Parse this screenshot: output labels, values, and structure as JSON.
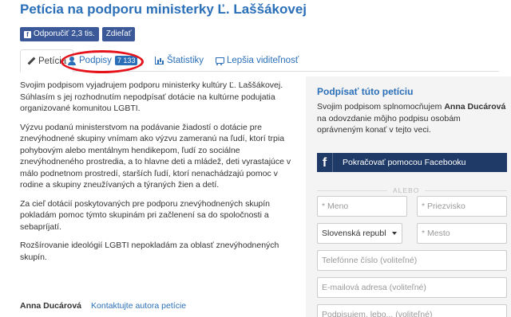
{
  "page": {
    "title": "Petícia na podporu ministerky Ľ. Laššákovej"
  },
  "share": {
    "recommend_label": "Odporučiť",
    "recommend_count": "2,3 tis.",
    "share_label": "Zdieľať"
  },
  "tabs": [
    {
      "label": "Petícia",
      "icon": "pencil-icon",
      "active": true
    },
    {
      "label": "Podpisy",
      "icon": "user-icon",
      "badge": "7 133",
      "active": false
    },
    {
      "label": "Štatistiky",
      "icon": "chart-icon",
      "active": false
    },
    {
      "label": "Lepšia viditeľnosť",
      "icon": "cart-icon",
      "active": false
    }
  ],
  "annotation": {
    "color": "#e5141c"
  },
  "body": {
    "paragraphs": [
      "Svojim podpisom vyjadrujem podporu ministerky kultúry Ľ. Laššákovej. Súhlasím s jej rozhodnutím nepodpísať dotácie na kultúrne podujatia organizované komunitou LGBTI.",
      "Výzvu podanú ministerstvom na podávanie žiadostí o dotácie pre znevýhodnené skupiny vnímam ako výzvu zameranú na ľudí, ktorí trpia pohybovým alebo mentálnym hendikepom, ľudí zo sociálne znevýhodneného prostredia, a to hlavne deti a mládež, deti vyrastajúce v málo podnetnom prostredí, starších ľudí, ktorí nenachádzajú pomoc v rodine a skupiny zneužívaných a týraných žien a detí.",
      "Za cieľ dotácií poskytovaných pre podporu znevýhodnených skupín pokladám pomoc týmto skupinám pri začlenení sa do spoločnosti a sebapríjatí.",
      "Rozšírovanie ideológií LGBTI nepokladám za oblasť znevýhodnených skupín."
    ]
  },
  "author": {
    "name": "Anna Ducárová",
    "contact_link": "Kontaktujte autora petície"
  },
  "sidebar": {
    "title": "Podpísať túto petíciu",
    "desc_prefix": "Svojim podpisom splnomocňujem",
    "desc_name": "Anna Ducárová",
    "desc_suffix": "na odovzdanie môjho podpisu osobám oprávneným konať v tejto veci.",
    "facebook_button": "Pokračovať pomocou Facebooku",
    "or_label": "ALEBO",
    "fields": {
      "first_name": "* Meno",
      "last_name": "* Priezvisko",
      "country": "Slovenská republ",
      "city": "* Mesto",
      "phone": "Telefónne číslo (voliteľné)",
      "email": "E-mailová adresa (voliteľné)",
      "comment": "Podpisujem, lebo... (voliteľné)"
    }
  },
  "colors": {
    "brand_blue": "#2a6fb8",
    "facebook": "#3b5998",
    "facebook_dark": "#1f3a66"
  }
}
